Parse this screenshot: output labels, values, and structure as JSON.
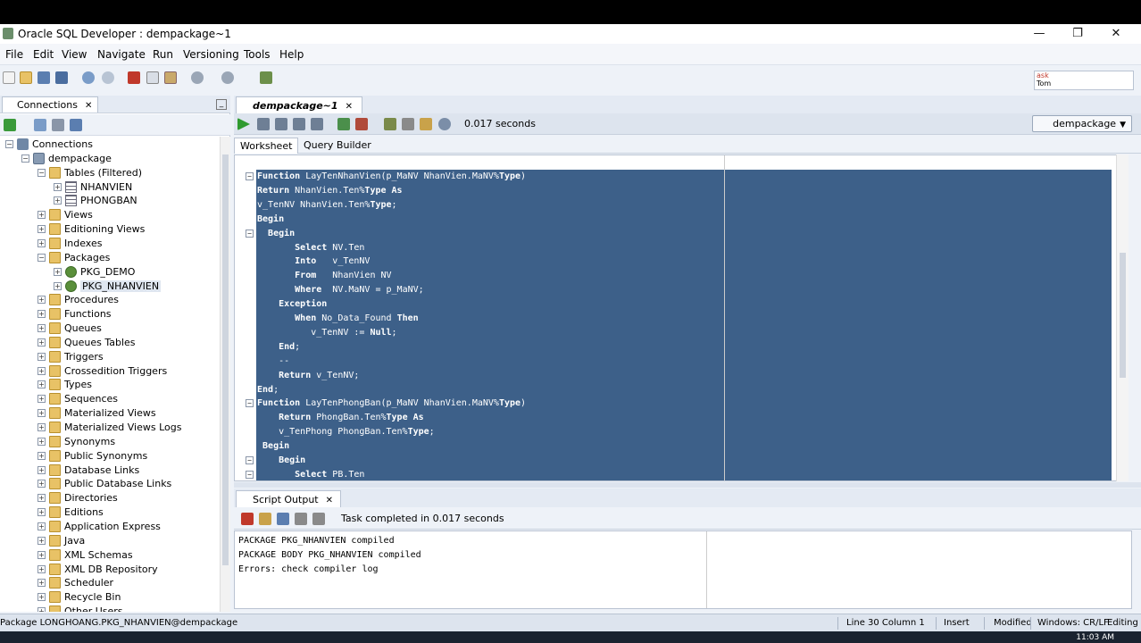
{
  "window": {
    "title": "Oracle SQL Developer : dempackage~1",
    "minimize": "—",
    "restore": "❐",
    "close": "✕"
  },
  "menu": [
    "File",
    "Edit",
    "View",
    "Navigate",
    "Run",
    "Versioning",
    "Tools",
    "Help"
  ],
  "asktom": {
    "line1": "ask",
    "line2": "Tom"
  },
  "connections_panel": {
    "tab_label": "Connections",
    "tree": [
      {
        "label": "Connections",
        "indent": 0,
        "expander": "−",
        "icon": "conn"
      },
      {
        "label": "dempackage",
        "indent": 1,
        "expander": "−",
        "icon": "db"
      },
      {
        "label": "Tables (Filtered)",
        "indent": 2,
        "expander": "−",
        "icon": "folder"
      },
      {
        "label": "NHANVIEN",
        "indent": 3,
        "expander": "+",
        "icon": "table"
      },
      {
        "label": "PHONGBAN",
        "indent": 3,
        "expander": "+",
        "icon": "table"
      },
      {
        "label": "Views",
        "indent": 2,
        "expander": "+",
        "icon": "folder"
      },
      {
        "label": "Editioning Views",
        "indent": 2,
        "expander": "+",
        "icon": "folder"
      },
      {
        "label": "Indexes",
        "indent": 2,
        "expander": "+",
        "icon": "folder"
      },
      {
        "label": "Packages",
        "indent": 2,
        "expander": "−",
        "icon": "folder"
      },
      {
        "label": "PKG_DEMO",
        "indent": 3,
        "expander": "+",
        "icon": "pkg"
      },
      {
        "label": "PKG_NHANVIEN",
        "indent": 3,
        "expander": "+",
        "icon": "pkg",
        "selected": true
      },
      {
        "label": "Procedures",
        "indent": 2,
        "expander": "+",
        "icon": "folder"
      },
      {
        "label": "Functions",
        "indent": 2,
        "expander": "+",
        "icon": "folder"
      },
      {
        "label": "Queues",
        "indent": 2,
        "expander": "+",
        "icon": "folder"
      },
      {
        "label": "Queues Tables",
        "indent": 2,
        "expander": "+",
        "icon": "folder"
      },
      {
        "label": "Triggers",
        "indent": 2,
        "expander": "+",
        "icon": "folder"
      },
      {
        "label": "Crossedition Triggers",
        "indent": 2,
        "expander": "+",
        "icon": "folder"
      },
      {
        "label": "Types",
        "indent": 2,
        "expander": "+",
        "icon": "folder"
      },
      {
        "label": "Sequences",
        "indent": 2,
        "expander": "+",
        "icon": "folder"
      },
      {
        "label": "Materialized Views",
        "indent": 2,
        "expander": "+",
        "icon": "folder"
      },
      {
        "label": "Materialized Views Logs",
        "indent": 2,
        "expander": "+",
        "icon": "folder"
      },
      {
        "label": "Synonyms",
        "indent": 2,
        "expander": "+",
        "icon": "folder"
      },
      {
        "label": "Public Synonyms",
        "indent": 2,
        "expander": "+",
        "icon": "folder"
      },
      {
        "label": "Database Links",
        "indent": 2,
        "expander": "+",
        "icon": "folder"
      },
      {
        "label": "Public Database Links",
        "indent": 2,
        "expander": "+",
        "icon": "folder"
      },
      {
        "label": "Directories",
        "indent": 2,
        "expander": "+",
        "icon": "folder"
      },
      {
        "label": "Editions",
        "indent": 2,
        "expander": "+",
        "icon": "folder"
      },
      {
        "label": "Application Express",
        "indent": 2,
        "expander": "+",
        "icon": "folder"
      },
      {
        "label": "Java",
        "indent": 2,
        "expander": "+",
        "icon": "folder"
      },
      {
        "label": "XML Schemas",
        "indent": 2,
        "expander": "+",
        "icon": "folder"
      },
      {
        "label": "XML DB Repository",
        "indent": 2,
        "expander": "+",
        "icon": "folder"
      },
      {
        "label": "Scheduler",
        "indent": 2,
        "expander": "+",
        "icon": "folder"
      },
      {
        "label": "Recycle Bin",
        "indent": 2,
        "expander": "+",
        "icon": "folder"
      },
      {
        "label": "Other Users",
        "indent": 2,
        "expander": "+",
        "icon": "folder"
      }
    ]
  },
  "editor": {
    "tab_label": "dempackage~1",
    "exec_time": "0.017 seconds",
    "connection": "dempackage",
    "subtabs": [
      "Worksheet",
      "Query Builder"
    ],
    "code_lines": [
      {
        "fold": "−",
        "parts": [
          {
            "t": "Function",
            "k": true
          },
          {
            "t": " LayTenNhanVien(p_MaNV NhanVien.MaNV%"
          },
          {
            "t": "Type",
            "k": true
          },
          {
            "t": ")"
          }
        ]
      },
      {
        "parts": [
          {
            "t": "Return",
            "k": true
          },
          {
            "t": " NhanVien.Ten%"
          },
          {
            "t": "Type As",
            "k": true
          }
        ]
      },
      {
        "parts": [
          {
            "t": "v_TenNV NhanVien.Ten%"
          },
          {
            "t": "Type",
            "k": true
          },
          {
            "t": ";"
          }
        ]
      },
      {
        "parts": [
          {
            "t": "Begin",
            "k": true
          }
        ]
      },
      {
        "fold": "−",
        "parts": [
          {
            "t": "  "
          },
          {
            "t": "Begin",
            "k": true
          }
        ]
      },
      {
        "parts": [
          {
            "t": "       "
          },
          {
            "t": "Select",
            "k": true
          },
          {
            "t": " NV.Ten"
          }
        ]
      },
      {
        "parts": [
          {
            "t": "       "
          },
          {
            "t": "Into",
            "k": true
          },
          {
            "t": "   v_TenNV"
          }
        ]
      },
      {
        "parts": [
          {
            "t": "       "
          },
          {
            "t": "From",
            "k": true
          },
          {
            "t": "   NhanVien NV"
          }
        ]
      },
      {
        "parts": [
          {
            "t": "       "
          },
          {
            "t": "Where",
            "k": true
          },
          {
            "t": "  NV.MaNV = p_MaNV;"
          }
        ]
      },
      {
        "parts": [
          {
            "t": "    "
          },
          {
            "t": "Exception",
            "k": true
          }
        ]
      },
      {
        "parts": [
          {
            "t": "       "
          },
          {
            "t": "When",
            "k": true
          },
          {
            "t": " No_Data_Found "
          },
          {
            "t": "Then",
            "k": true
          }
        ]
      },
      {
        "parts": [
          {
            "t": "          v_TenNV := "
          },
          {
            "t": "Null",
            "k": true
          },
          {
            "t": ";"
          }
        ]
      },
      {
        "parts": [
          {
            "t": "    "
          },
          {
            "t": "End",
            "k": true
          },
          {
            "t": ";"
          }
        ]
      },
      {
        "parts": [
          {
            "t": "    --"
          }
        ]
      },
      {
        "parts": [
          {
            "t": "    "
          },
          {
            "t": "Return",
            "k": true
          },
          {
            "t": " v_TenNV;"
          }
        ]
      },
      {
        "parts": [
          {
            "t": "End",
            "k": true
          },
          {
            "t": ";"
          }
        ]
      },
      {
        "fold": "−",
        "parts": [
          {
            "t": "Function",
            "k": true
          },
          {
            "t": " LayTenPhongBan(p_MaNV NhanVien.MaNV%"
          },
          {
            "t": "Type",
            "k": true
          },
          {
            "t": ")"
          }
        ]
      },
      {
        "parts": [
          {
            "t": "    "
          },
          {
            "t": "Return",
            "k": true
          },
          {
            "t": " PhongBan.Ten%"
          },
          {
            "t": "Type As",
            "k": true
          }
        ]
      },
      {
        "parts": [
          {
            "t": "    v_TenPhong PhongBan.Ten%"
          },
          {
            "t": "Type",
            "k": true
          },
          {
            "t": ";"
          }
        ]
      },
      {
        "parts": [
          {
            "t": " "
          },
          {
            "t": "Begin",
            "k": true
          }
        ]
      },
      {
        "fold": "−",
        "parts": [
          {
            "t": "    "
          },
          {
            "t": "Begin",
            "k": true
          }
        ]
      },
      {
        "fold": "−",
        "parts": [
          {
            "t": "       "
          },
          {
            "t": "Select",
            "k": true
          },
          {
            "t": " PB.Ten"
          }
        ]
      }
    ]
  },
  "script_output": {
    "tab_label": "Script Output",
    "message": "Task completed in 0.017 seconds",
    "lines": [
      "PACKAGE PKG_NHANVIEN compiled",
      "PACKAGE BODY PKG_NHANVIEN compiled",
      "Errors: check compiler log"
    ]
  },
  "statusbar": {
    "left": "Package LONGHOANG.PKG_NHANVIEN@dempackage",
    "position": "Line 30 Column 1",
    "mode": "Insert",
    "state": "Modified",
    "line_endings": "Windows: CR/LF",
    "edit_mode": "Editing"
  },
  "clock": "11:03 AM",
  "colors": {
    "selection": "#3d6089",
    "background": "#eef2f8"
  }
}
